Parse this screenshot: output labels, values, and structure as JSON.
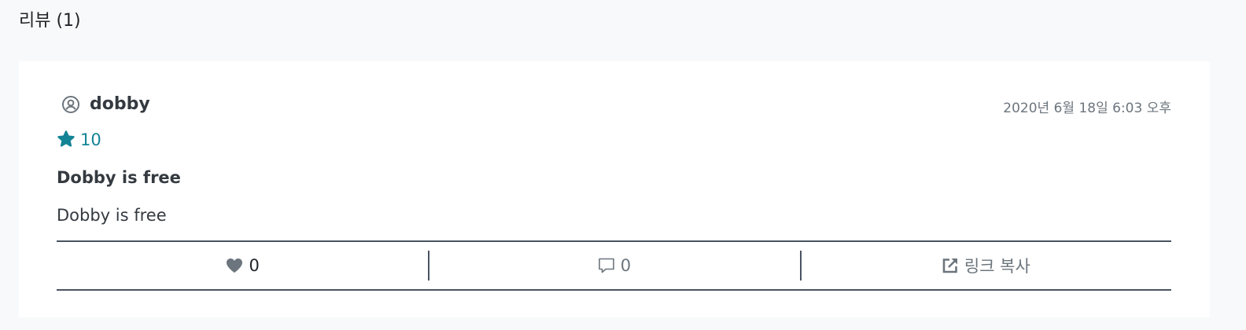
{
  "section": {
    "title": "리뷰 (1)"
  },
  "review": {
    "username": "dobby",
    "date": "2020년 6월 18일 6:03 오후",
    "rating": "10",
    "title": "Dobby is free",
    "body": "Dobby is free"
  },
  "actions": {
    "like_count": "0",
    "comment_count": "0",
    "share_label": "링크 복사"
  },
  "icons": {
    "user": "user-circle-icon",
    "rating": "star-badge-icon",
    "like": "heart-icon",
    "comment": "comment-icon",
    "share": "external-link-icon"
  },
  "colors": {
    "accent": "#138496",
    "star": "#138496",
    "muted": "#6c757d",
    "divider": "#4a5361"
  }
}
